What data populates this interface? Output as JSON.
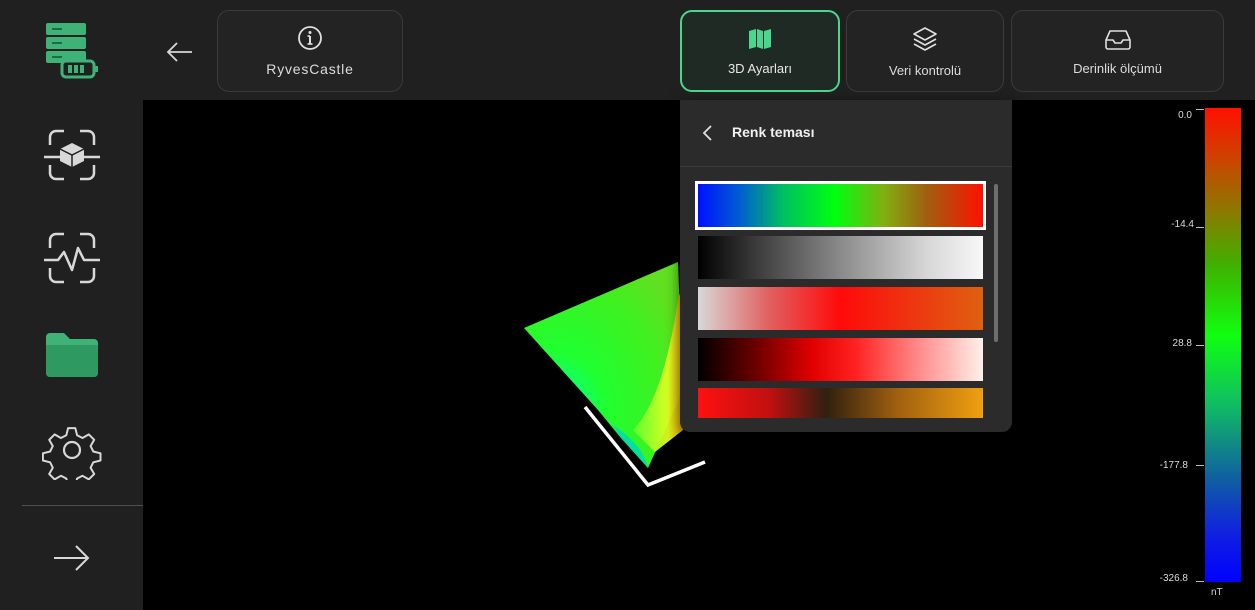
{
  "app": {
    "project_name": "RyvesCastle"
  },
  "toolbar": {
    "buttons": [
      {
        "label": "3D Ayarları",
        "icon": "map-icon",
        "active": true
      },
      {
        "label": "Veri kontrolü",
        "icon": "layers-icon",
        "active": false
      },
      {
        "label": "Derinlik ölçümü",
        "icon": "inbox-icon",
        "active": false
      }
    ]
  },
  "sidebar": {
    "items": [
      {
        "icon": "device-battery-icon"
      },
      {
        "icon": "scan-3d-icon"
      },
      {
        "icon": "scan-signal-icon"
      },
      {
        "icon": "folder-icon"
      },
      {
        "icon": "settings-gear-icon"
      },
      {
        "icon": "arrow-right-icon"
      }
    ]
  },
  "panel": {
    "title": "Renk teması",
    "themes": [
      {
        "name": "blue-green-red",
        "selected": true
      },
      {
        "name": "grayscale",
        "selected": false
      },
      {
        "name": "light-red-orange",
        "selected": false
      },
      {
        "name": "black-red-white",
        "selected": false
      },
      {
        "name": "red-orange",
        "selected": false
      }
    ]
  },
  "scale": {
    "ticks": [
      "0.0",
      "-14.4",
      "28.8",
      "-177.8",
      "-326.8"
    ],
    "unit": "nT"
  },
  "colors": {
    "accent": "#4ad68e",
    "sidebar_bg": "#202020",
    "panel_bg": "#2b2b2b"
  }
}
